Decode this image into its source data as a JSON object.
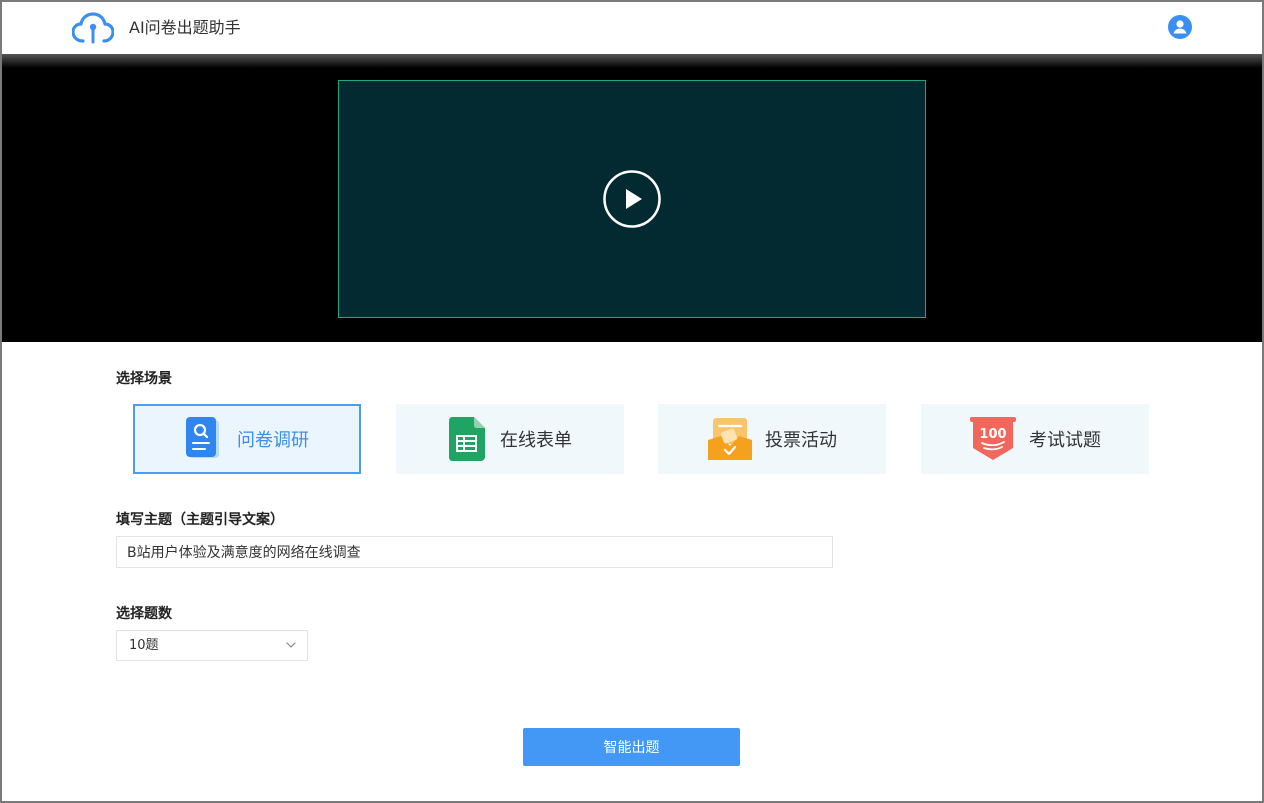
{
  "header": {
    "title": "AI问卷出题助手",
    "logo_icon": "cloud-upload-icon",
    "avatar_icon": "user-avatar-icon",
    "accent_color": "#3b8ff0"
  },
  "hero": {
    "play_icon": "play-icon",
    "video_bg": "#022a30",
    "video_border": "#1fa87a"
  },
  "scene": {
    "label": "选择场景",
    "selected": "问卷调研",
    "options": [
      {
        "label": "问卷调研",
        "icon": "survey-document-icon"
      },
      {
        "label": "在线表单",
        "icon": "spreadsheet-form-icon"
      },
      {
        "label": "投票活动",
        "icon": "ballot-box-icon"
      },
      {
        "label": "考试试题",
        "icon": "exam-score-100-icon"
      }
    ]
  },
  "topic": {
    "label": "填写主题（主题引导文案）",
    "value": "B站用户体验及满意度的网络在线调查"
  },
  "count": {
    "label": "选择题数",
    "value": "10题",
    "chevron_icon": "chevron-down-icon"
  },
  "submit": {
    "label": "智能出题",
    "color": "#4298f4"
  }
}
